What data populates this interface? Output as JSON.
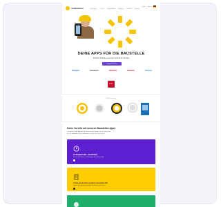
{
  "header": {
    "logo": "myHandwerker",
    "nav": [
      "Funktionen",
      "Preise",
      "Handwerker",
      "Industrie",
      "Partner",
      "Kontakt"
    ],
    "utility": [
      "Login",
      "Demo"
    ]
  },
  "hero": {
    "title": "DEINE APPS FÜR DIE BAUSTELLE",
    "subtitle": "Einfache Software-Lösungen speziell für das Bau",
    "cta": "Kostenlos testen"
  },
  "store_logos": [
    "Stuttgart",
    "Handwerk",
    "Bauhaus",
    "Bauwelt",
    "Holzbau"
  ],
  "badge_label": "HWK",
  "awards_caption": "Ausgezeichnet",
  "section": {
    "title": "Deine Vorteile mit unseren Baustellen-Apps",
    "lines": [
      "Mit unseren Apps digitalisierst du die Zeiterfassung und Dokumentation",
      "auf der Baustelle schnell und einfach. Spare Zeit und Kosten."
    ]
  },
  "promos": [
    {
      "title": "24 SCHNITZ ZEIT - BAUSTAGE",
      "text": "Erfasse Arbeitszeiten direkt auf der Baustelle per App.",
      "color": "#5d1fd0"
    },
    {
      "title": "Lorem ipsum dolor sit amet consectetur elit",
      "text": "Digitale Bautagebuch und Dokumentation für dein Team.",
      "color": "#ffcc00"
    },
    {
      "title": "",
      "text": "",
      "color": "#1fae6a"
    }
  ],
  "colors": {
    "accent": "#f7c200",
    "cta": "#6d3fd6"
  }
}
